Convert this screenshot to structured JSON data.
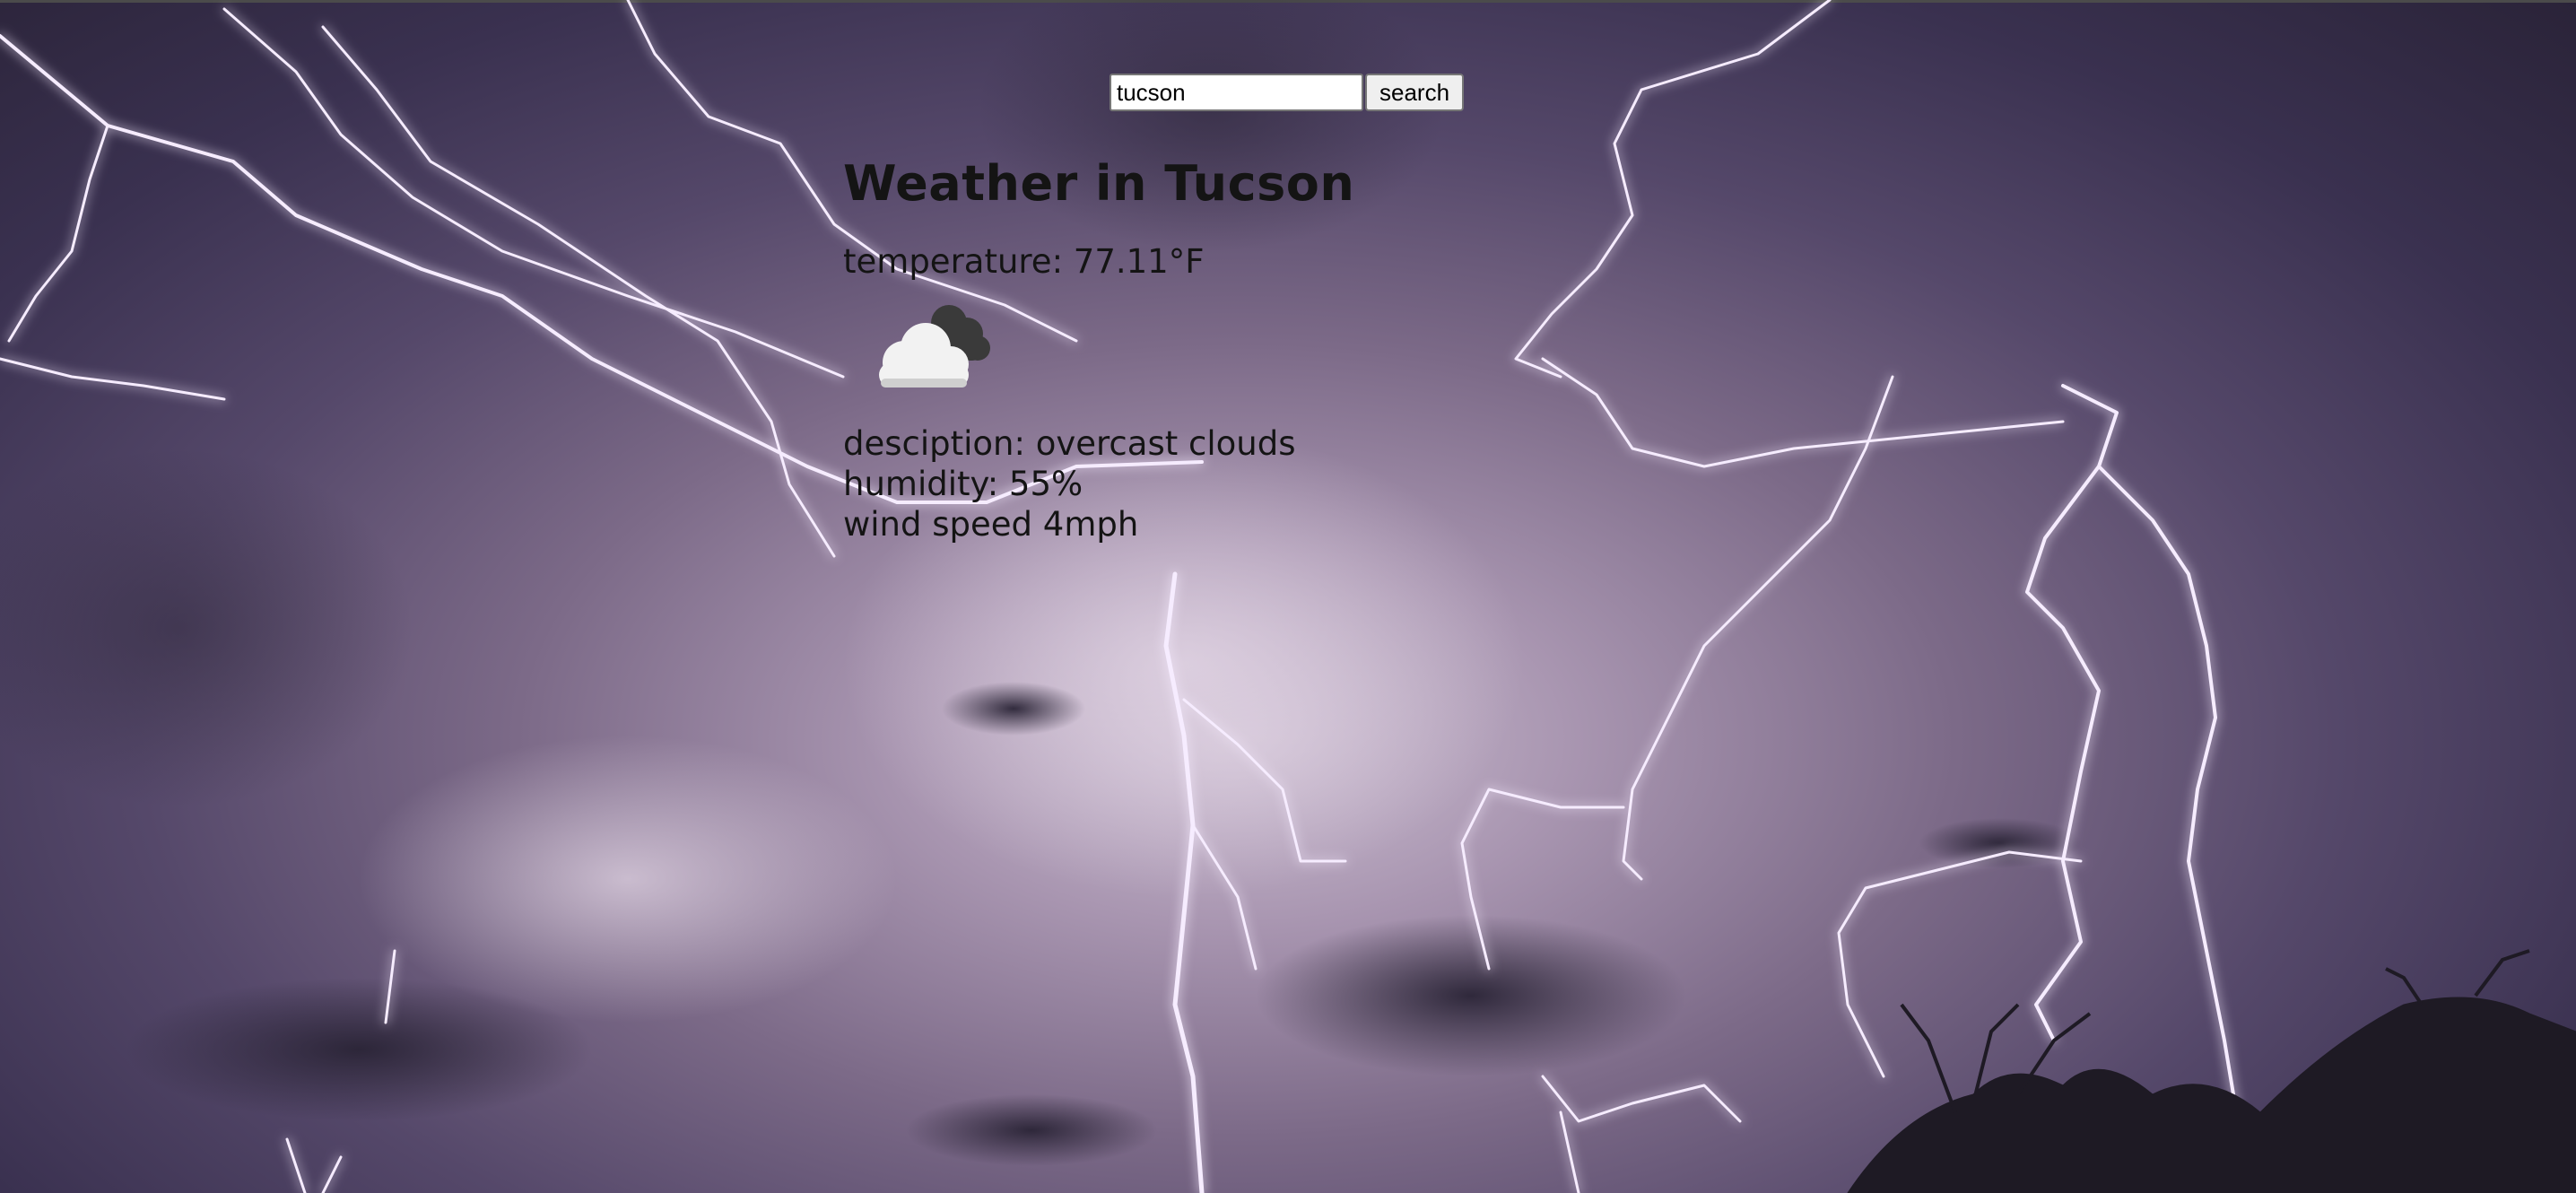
{
  "search": {
    "value": "tucson",
    "button_label": "search"
  },
  "weather": {
    "title": "Weather in Tucson",
    "temperature": "temperature: 77.11°F",
    "icon": "overcast-clouds-icon",
    "description": "desciption: overcast clouds",
    "humidity": "humidity: 55%",
    "wind": "wind speed 4mph"
  },
  "background": {
    "subject": "lightning-storm",
    "colors": [
      "#2a2338",
      "#55486a",
      "#a895b0",
      "#f2e6ff"
    ]
  }
}
